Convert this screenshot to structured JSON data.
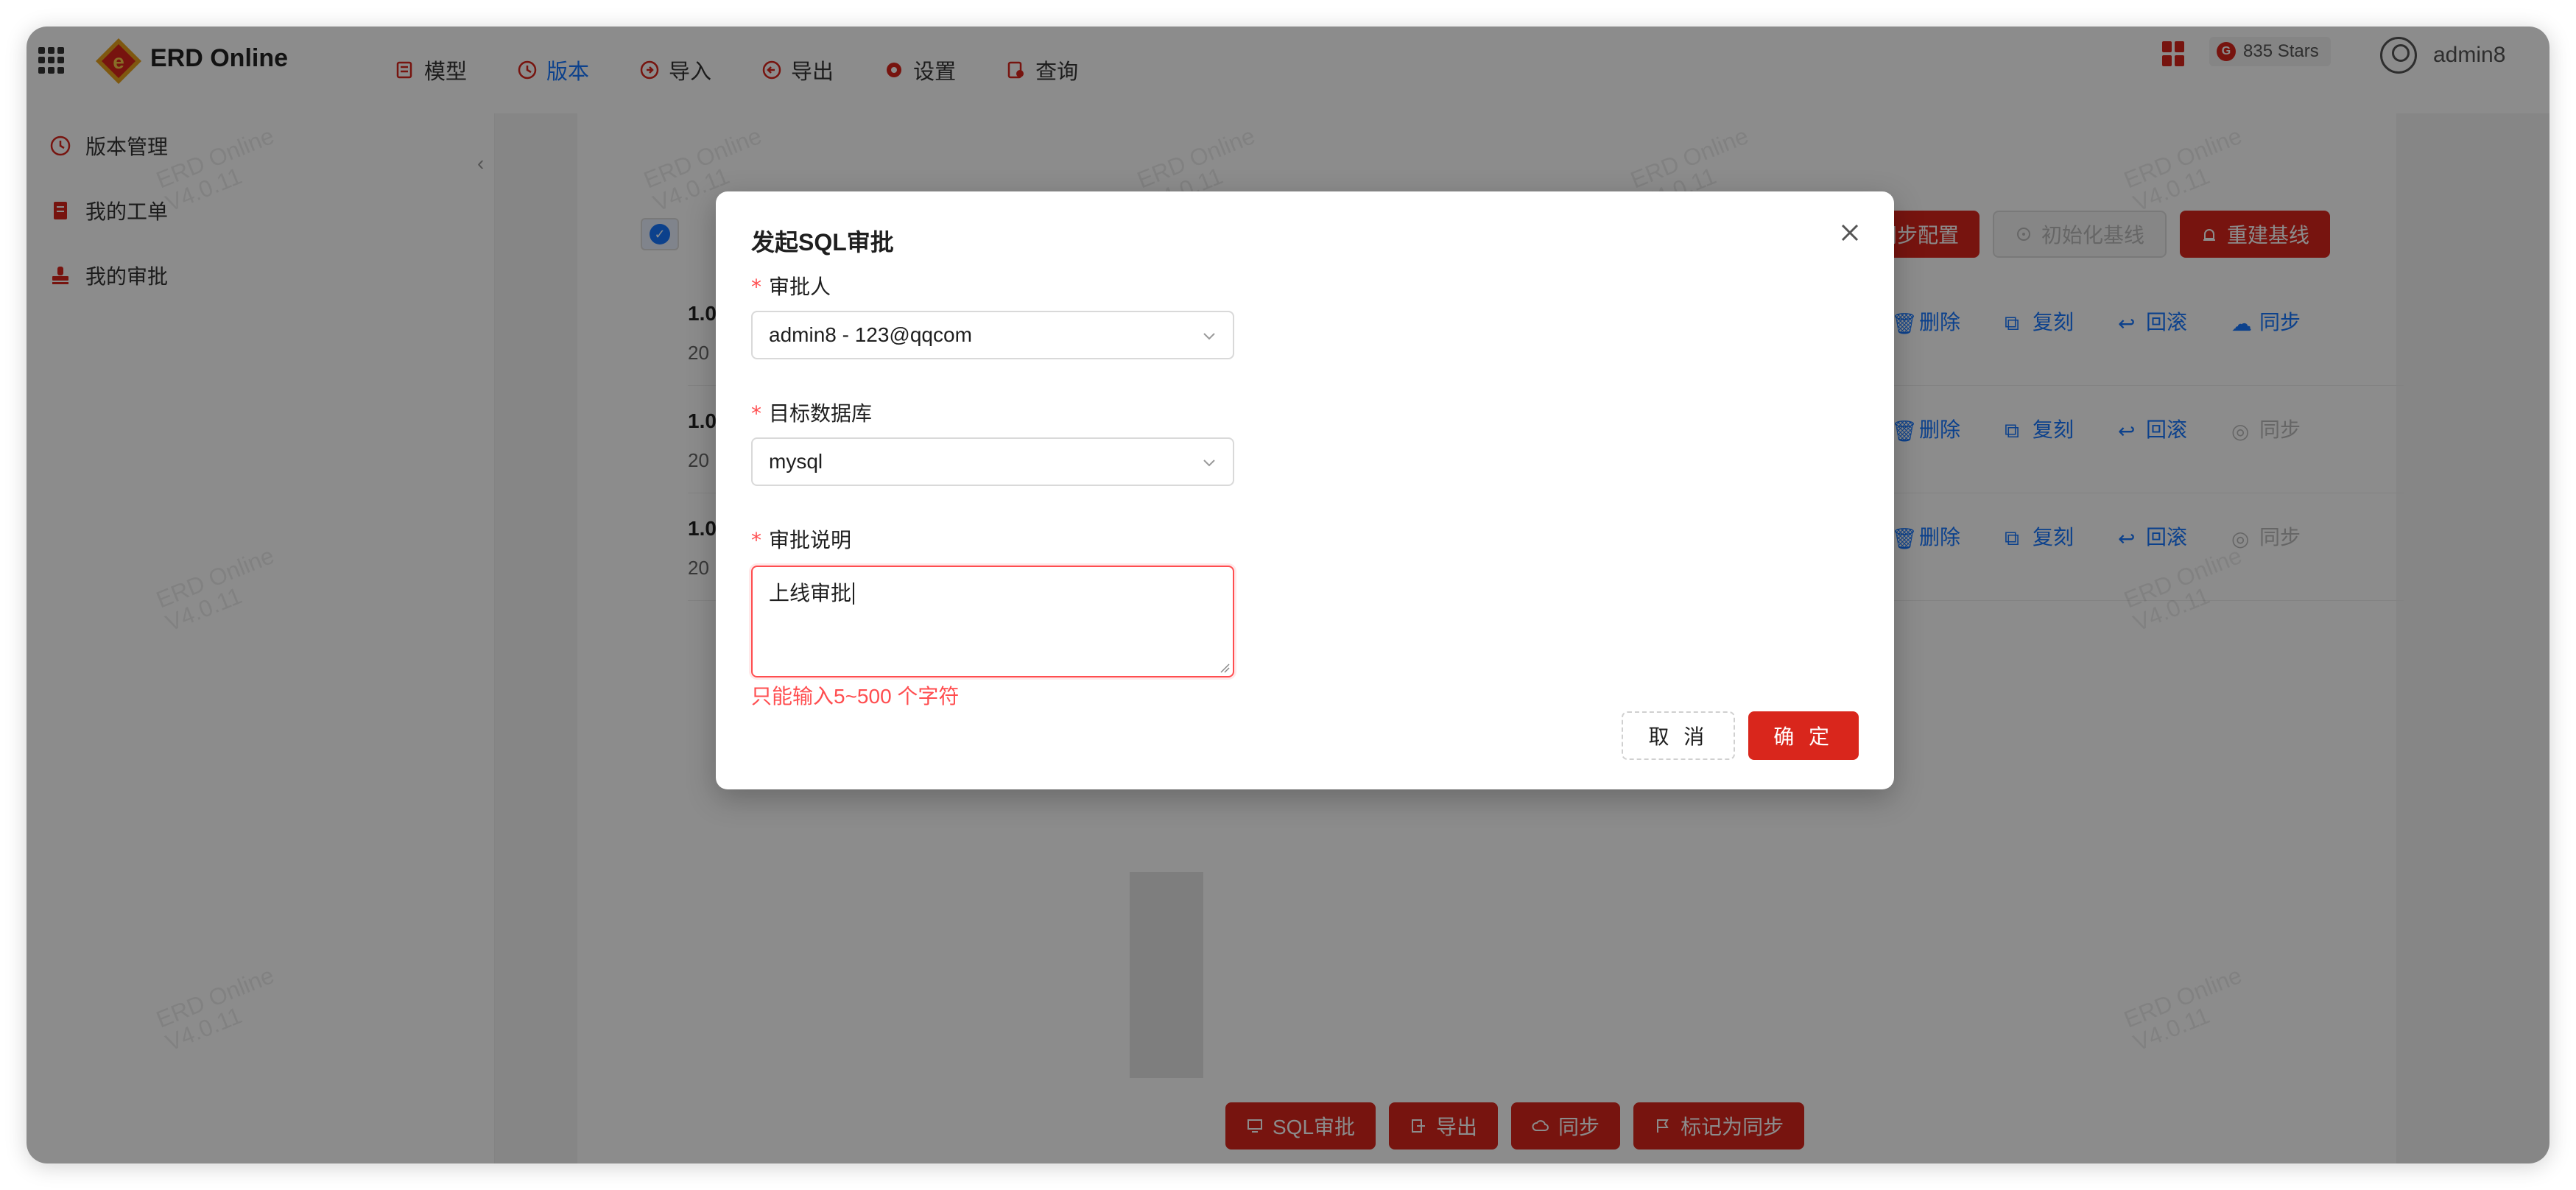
{
  "app": {
    "title": "ERD Online",
    "watermark_line1": "ERD Online",
    "watermark_line2": "V4.0.11"
  },
  "nav": [
    {
      "label": "模型",
      "icon": "model-icon",
      "active": false
    },
    {
      "label": "版本",
      "icon": "version-icon",
      "active": true
    },
    {
      "label": "导入",
      "icon": "import-icon",
      "active": false
    },
    {
      "label": "导出",
      "icon": "export-icon",
      "active": false
    },
    {
      "label": "设置",
      "icon": "settings-icon",
      "active": false
    },
    {
      "label": "查询",
      "icon": "query-icon",
      "active": false
    }
  ],
  "topbar": {
    "stars": "835 Stars",
    "username": "admin8"
  },
  "sidebar": {
    "items": [
      {
        "label": "版本管理",
        "icon": "history-icon"
      },
      {
        "label": "我的工单",
        "icon": "ticket-icon"
      },
      {
        "label": "我的审批",
        "icon": "approval-icon"
      }
    ]
  },
  "toolbar": {
    "sync_config": "同步配置",
    "init_baseline": "初始化基线",
    "rebuild_baseline": "重建基线"
  },
  "versions": [
    {
      "num": "1.0",
      "date": "20",
      "actions": [
        "删除",
        "复刻",
        "回滚",
        "同步"
      ],
      "sync_enabled": true
    },
    {
      "num": "1.0",
      "date": "20",
      "actions": [
        "删除",
        "复刻",
        "回滚",
        "同步"
      ],
      "sync_enabled": false
    },
    {
      "num": "1.0",
      "date": "20",
      "actions": [
        "删除",
        "复刻",
        "回滚",
        "同步"
      ],
      "sync_enabled": false
    }
  ],
  "bottom_buttons": {
    "sql_approval": "SQL审批",
    "export": "导出",
    "sync": "同步",
    "mark_synced": "标记为同步"
  },
  "modal": {
    "title": "发起SQL审批",
    "approver_label": "审批人",
    "approver_value": "admin8 - 123@qqcom",
    "db_label": "目标数据库",
    "db_value": "mysql",
    "desc_label": "审批说明",
    "desc_value": "上线审批",
    "error": "只能输入5~500 个字符",
    "cancel": "取 消",
    "ok": "确 定"
  },
  "colors": {
    "brand_red": "#d9261c",
    "link_blue": "#1677ff",
    "error_red": "#ff4d4f"
  }
}
